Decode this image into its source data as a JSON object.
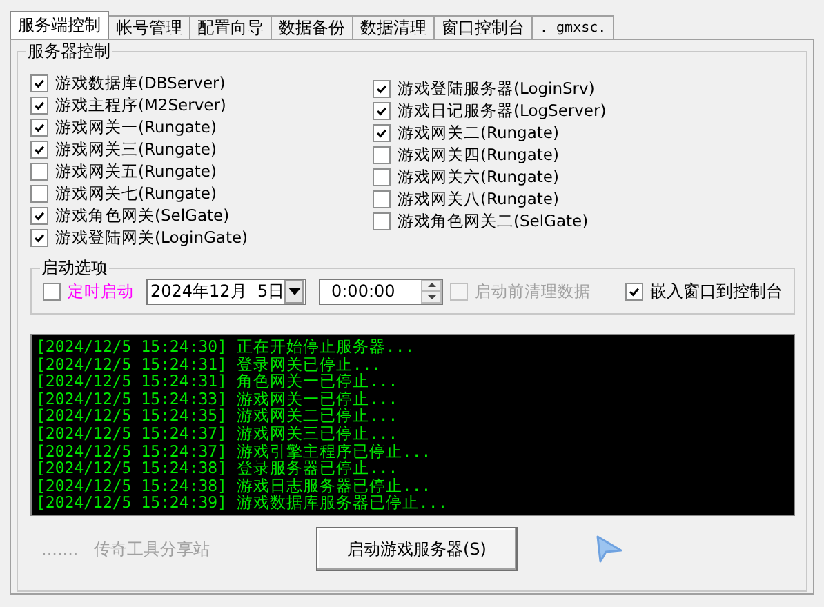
{
  "tabs": [
    {
      "label": "服务端控制",
      "selected": true
    },
    {
      "label": "帐号管理",
      "selected": false
    },
    {
      "label": "配置向导",
      "selected": false
    },
    {
      "label": "数据备份",
      "selected": false
    },
    {
      "label": "数据清理",
      "selected": false
    },
    {
      "label": "窗口控制台",
      "selected": false
    },
    {
      "label": ". gmxsc.",
      "selected": false
    }
  ],
  "server_control": {
    "title": "服务器控制",
    "left": [
      {
        "label": "游戏数据库(DBServer)",
        "checked": true
      },
      {
        "label": "游戏主程序(M2Server)",
        "checked": true
      },
      {
        "label": "游戏网关一(Rungate)",
        "checked": true
      },
      {
        "label": "游戏网关三(Rungate)",
        "checked": true
      },
      {
        "label": "游戏网关五(Rungate)",
        "checked": false
      },
      {
        "label": "游戏网关七(Rungate)",
        "checked": false
      },
      {
        "label": "游戏角色网关(SelGate)",
        "checked": true
      },
      {
        "label": "游戏登陆网关(LoginGate)",
        "checked": true
      }
    ],
    "right": [
      {
        "label": "游戏登陆服务器(LoginSrv)",
        "checked": true
      },
      {
        "label": "游戏日记服务器(LogServer)",
        "checked": true
      },
      {
        "label": "游戏网关二(Rungate)",
        "checked": true
      },
      {
        "label": "游戏网关四(Rungate)",
        "checked": false
      },
      {
        "label": "游戏网关六(Rungate)",
        "checked": false
      },
      {
        "label": "游戏网关八(Rungate)",
        "checked": false
      },
      {
        "label": "游戏角色网关二(SelGate)",
        "checked": false
      }
    ]
  },
  "start_options": {
    "title": "启动选项",
    "timed_start": {
      "label": "定时启动",
      "checked": false
    },
    "date": {
      "value": "2024年12月  5日"
    },
    "time": {
      "value": "0:00:00"
    },
    "clear_before_start": {
      "label": "启动前清理数据",
      "checked": false,
      "disabled": true
    },
    "embed_console": {
      "label": "嵌入窗口到控制台",
      "checked": true
    }
  },
  "log": [
    {
      "time": "[2024/12/5 15:24:30]",
      "message": "正在开始停止服务器..."
    },
    {
      "time": "[2024/12/5 15:24:31]",
      "message": "登录网关已停止..."
    },
    {
      "time": "[2024/12/5 15:24:31]",
      "message": "角色网关一已停止..."
    },
    {
      "time": "[2024/12/5 15:24:33]",
      "message": "游戏网关一已停止..."
    },
    {
      "time": "[2024/12/5 15:24:35]",
      "message": "游戏网关二已停止..."
    },
    {
      "time": "[2024/12/5 15:24:37]",
      "message": "游戏网关三已停止..."
    },
    {
      "time": "[2024/12/5 15:24:37]",
      "message": "游戏引擎主程序已停止..."
    },
    {
      "time": "[2024/12/5 15:24:38]",
      "message": "登录服务器已停止..."
    },
    {
      "time": "[2024/12/5 15:24:38]",
      "message": "游戏日志服务器已停止..."
    },
    {
      "time": "[2024/12/5 15:24:39]",
      "message": "游戏数据库服务器已停止..."
    }
  ],
  "footer_link": {
    "dots": ".......",
    "label": "传奇工具分享站"
  },
  "start_button": {
    "label": "启动游戏服务器(S)"
  }
}
